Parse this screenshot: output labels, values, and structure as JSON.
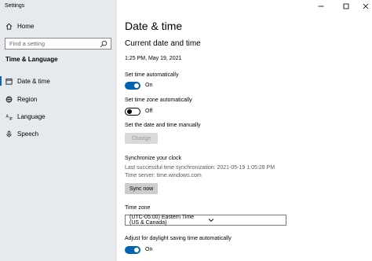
{
  "window": {
    "title": "Settings"
  },
  "sidebar": {
    "home_label": "Home",
    "search_placeholder": "Find a setting",
    "section_label": "Time & Language",
    "items": [
      {
        "label": "Date & time",
        "icon": "calendar-icon",
        "active": true
      },
      {
        "label": "Region",
        "icon": "globe-icon",
        "active": false
      },
      {
        "label": "Language",
        "icon": "language-icon",
        "active": false
      },
      {
        "label": "Speech",
        "icon": "microphone-icon",
        "active": false
      }
    ]
  },
  "main": {
    "title": "Date & time",
    "subtitle": "Current date and time",
    "current_time": "1:25 PM, May 19, 2021",
    "set_time_auto": {
      "label": "Set time automatically",
      "state": "On"
    },
    "set_zone_auto": {
      "label": "Set time zone automatically",
      "state": "Off"
    },
    "manual": {
      "label": "Set the date and time manually",
      "button": "Change"
    },
    "sync": {
      "title": "Synchronize your clock",
      "last_sync": "Last successful time synchronization: 2021-05-19 1:05:28 PM",
      "server": "Time server: time.windows.com",
      "button": "Sync now"
    },
    "timezone": {
      "label": "Time zone",
      "value": "(UTC-05:00) Eastern Time (US & Canada)"
    },
    "dst": {
      "label": "Adjust for daylight saving time automatically",
      "state": "On"
    }
  },
  "colors": {
    "accent": "#0063b1",
    "sidebar_bg": "#e6eaee"
  }
}
